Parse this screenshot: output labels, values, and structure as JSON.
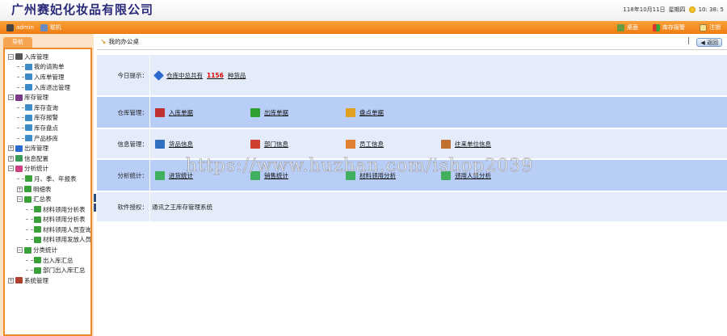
{
  "header": {
    "company": "广州赛妃化妆品有限公司",
    "date": "118年10月11日",
    "weekday": "星期四",
    "time": "10: 38: 5"
  },
  "topbar": {
    "user": "admin",
    "status": "联机",
    "desktop": "桌面",
    "stock_alert": "库存报警",
    "logout": "注销"
  },
  "sidebar": {
    "tab": "导航",
    "tree": [
      {
        "label": "入库管理",
        "level": 0,
        "toggle": "−",
        "color": "#555"
      },
      {
        "label": "我的请购单",
        "level": 1,
        "color": "#3a8bc8"
      },
      {
        "label": "入库单管理",
        "level": 1,
        "color": "#3a8bc8"
      },
      {
        "label": "入库退出管理",
        "level": 1,
        "color": "#3a8bc8"
      },
      {
        "label": "库存管理",
        "level": 0,
        "toggle": "−",
        "color": "#7a3a8a"
      },
      {
        "label": "库存查询",
        "level": 1,
        "color": "#3a8bc8"
      },
      {
        "label": "库存报警",
        "level": 1,
        "color": "#3a8bc8"
      },
      {
        "label": "库存盘点",
        "level": 1,
        "color": "#3a8bc8"
      },
      {
        "label": "产品移库",
        "level": 1,
        "color": "#3a8bc8"
      },
      {
        "label": "出库管理",
        "level": 0,
        "toggle": "+",
        "color": "#2a6ad0"
      },
      {
        "label": "信息配置",
        "level": 0,
        "toggle": "+",
        "color": "#3a9a5a"
      },
      {
        "label": "分析统计",
        "level": 0,
        "toggle": "−",
        "color": "#d04080"
      },
      {
        "label": "月、季、年报表",
        "level": 1,
        "color": "#3aa03a"
      },
      {
        "label": "明细表",
        "level": 1,
        "toggle": "+",
        "color": "#3aa03a"
      },
      {
        "label": "汇总表",
        "level": 1,
        "toggle": "−",
        "color": "#3aa03a"
      },
      {
        "label": "材料领用分析表",
        "level": 2,
        "color": "#3aa03a"
      },
      {
        "label": "材料领用分析表",
        "level": 2,
        "color": "#3aa03a"
      },
      {
        "label": "材料领用人员查询",
        "level": 2,
        "color": "#3aa03a"
      },
      {
        "label": "材料领用发放人员",
        "level": 2,
        "color": "#3aa03a"
      },
      {
        "label": "分类统计",
        "level": 1,
        "toggle": "−",
        "color": "#3aa03a"
      },
      {
        "label": "出入库汇总",
        "level": 2,
        "color": "#3aa03a"
      },
      {
        "label": "部门出入库汇总",
        "level": 2,
        "color": "#3aa03a"
      },
      {
        "label": "系统管理",
        "level": 0,
        "toggle": "+",
        "color": "#b04030"
      }
    ]
  },
  "main": {
    "breadcrumb": "我的办公桌",
    "back": "返回",
    "today": {
      "label": "今日提示：",
      "prefix": "仓库中总共有",
      "count": "1156",
      "suffix": "种货品"
    },
    "rows": [
      {
        "label": "仓库管理：",
        "links": [
          {
            "text": "入库单据",
            "color": "#c03030"
          },
          {
            "text": "出库单据",
            "color": "#30a030"
          },
          {
            "text": "盘点单据",
            "color": "#e0a020"
          }
        ]
      },
      {
        "label": "信息管理：",
        "links": [
          {
            "text": "货品信息",
            "color": "#3070c0"
          },
          {
            "text": "部门信息",
            "color": "#d04030"
          },
          {
            "text": "员工信息",
            "color": "#e08030"
          },
          {
            "text": "往来单位信息",
            "color": "#c07030"
          }
        ]
      },
      {
        "label": "分析统计：",
        "links": [
          {
            "text": "进货统计",
            "color": "#40b060"
          },
          {
            "text": "销售统计",
            "color": "#40b060"
          },
          {
            "text": "材料领用分析",
            "color": "#40b060"
          },
          {
            "text": "领用人员分析",
            "color": "#40b060"
          }
        ]
      }
    ],
    "license": {
      "label": "软件授权：",
      "value": "通讯之王库存管理系统"
    }
  },
  "watermark": "https://www.huzhan.com/ishop2039"
}
